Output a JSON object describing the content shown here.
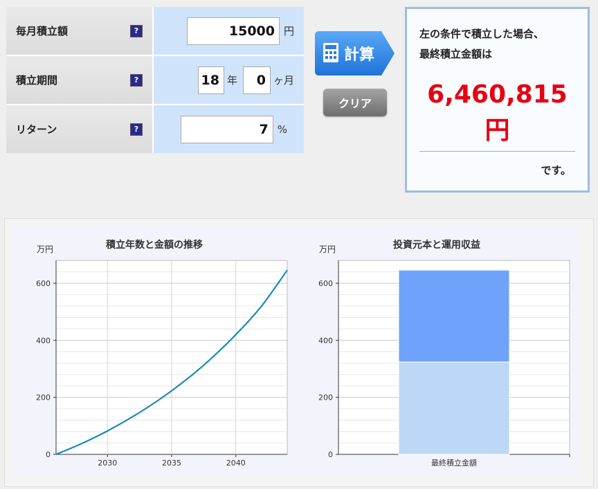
{
  "form": {
    "rows": [
      {
        "label": "毎月積立額",
        "help": "?",
        "value": "15000",
        "unit": "円"
      },
      {
        "label": "積立期間",
        "help": "?",
        "years": "18",
        "years_unit": "年",
        "months": "0",
        "months_unit": "ヶ月"
      },
      {
        "label": "リターン",
        "help": "?",
        "value": "7",
        "unit": "%"
      }
    ]
  },
  "buttons": {
    "calc": "計算",
    "clear": "クリア"
  },
  "result": {
    "line1": "左の条件で積立した場合、",
    "line2": "最終積立金額は",
    "amount": "6,460,815",
    "amount_unit": "円",
    "suffix": "です。"
  },
  "charts": [
    {
      "type": "line",
      "title": "積立年数と金額の推移",
      "ylabel": "万円",
      "ylim": [
        0,
        680
      ],
      "xlim": [
        2026,
        2044
      ],
      "yticks": [
        "0",
        "200",
        "400",
        "600"
      ],
      "xticks": [
        "2030",
        "2035",
        "2040"
      ],
      "x": [
        2026,
        2028,
        2030,
        2032,
        2034,
        2036,
        2038,
        2040,
        2042,
        2044
      ],
      "y": [
        0,
        38,
        82,
        133,
        191,
        257,
        333,
        420,
        520,
        646
      ],
      "color": "#1a8ab8"
    },
    {
      "type": "bar",
      "title": "投資元本と運用収益",
      "ylabel": "万円",
      "ylim": [
        0,
        680
      ],
      "yticks": [
        "0",
        "200",
        "400",
        "600"
      ],
      "categories": [
        "最終積立金額"
      ],
      "series": [
        {
          "values": [
            324
          ],
          "color": "#bcd8f6"
        },
        {
          "values": [
            322
          ],
          "color": "#6fa2fb"
        }
      ]
    }
  ],
  "colors": {
    "amount": "#e60012",
    "value_cell": "#cfe4fb",
    "result_border": "#9ebcdf",
    "calc_button": "#2c86e8"
  }
}
